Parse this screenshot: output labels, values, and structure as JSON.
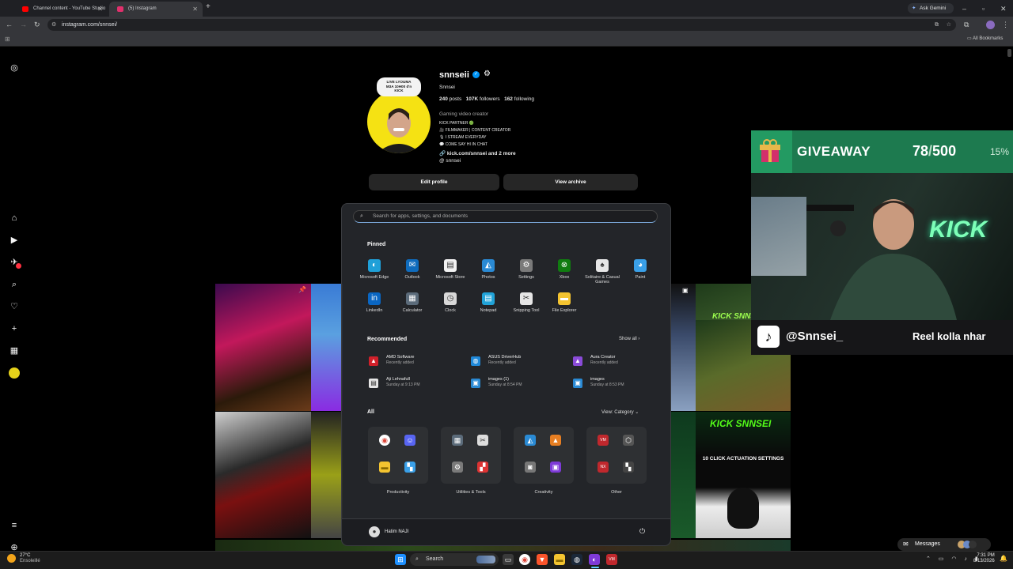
{
  "browser": {
    "tabs": [
      {
        "title": "Channel content - YouTube Studio",
        "favicon_color": "#ff0000"
      },
      {
        "title": "(5) Instagram",
        "favicon_color": "#e1306c"
      }
    ],
    "new_tab": "+",
    "ask_gemini": "Ask Gemini",
    "url": "instagram.com/snnsei/",
    "all_bookmarks": "All Bookmarks"
  },
  "profile": {
    "username": "snnseii",
    "display_name": "Snnsei",
    "live_badge": [
      "LIVE LYOUMA",
      "M3A 10H00 d'n",
      "KICK"
    ],
    "posts_count": "240",
    "posts_label": "posts",
    "followers_count": "107K",
    "followers_label": "followers",
    "following_count": "162",
    "following_label": "following",
    "category": "Gaming video creator",
    "bio_lines": [
      "KICK PARTNER 🟢",
      "🎥 FILMMAKER | CONTENT CREATOR",
      "🎙 I STREAM EVERYDAY",
      "💬 COME SAY HI IN CHAT"
    ],
    "link": "kick.com/snnsei and 2 more",
    "threads": "snnsei",
    "edit_profile": "Edit profile",
    "view_archive": "View archive"
  },
  "start_menu": {
    "search_placeholder": "Search for apps, settings, and documents",
    "pinned_title": "Pinned",
    "pinned": [
      {
        "label": "Microsoft Edge",
        "icon": "edge-icon",
        "color": "#1fa0d8"
      },
      {
        "label": "Outlook",
        "icon": "outlook-icon",
        "color": "#0f6cbd"
      },
      {
        "label": "Microsoft Store",
        "icon": "store-icon",
        "color": "#f2f2f2"
      },
      {
        "label": "Photos",
        "icon": "photos-icon",
        "color": "#2a8ad4"
      },
      {
        "label": "Settings",
        "icon": "settings-icon",
        "color": "#7a7a7a"
      },
      {
        "label": "Xbox",
        "icon": "xbox-icon",
        "color": "#107c10"
      },
      {
        "label": "Solitaire & Casual Games",
        "icon": "cards-icon",
        "color": "#e6e6e6"
      },
      {
        "label": "Paint",
        "icon": "paint-icon",
        "color": "#3aa0e8"
      },
      {
        "label": "LinkedIn",
        "icon": "linkedin-icon",
        "color": "#0a66c2"
      },
      {
        "label": "Calculator",
        "icon": "calculator-icon",
        "color": "#5b6b7a"
      },
      {
        "label": "Clock",
        "icon": "clock-icon",
        "color": "#d8d8d8"
      },
      {
        "label": "Notepad",
        "icon": "notepad-icon",
        "color": "#21a3d8"
      },
      {
        "label": "Snipping Tool",
        "icon": "snip-icon",
        "color": "#e6e6e6"
      },
      {
        "label": "File Explorer",
        "icon": "folder-icon",
        "color": "#f4c430"
      }
    ],
    "recommended_title": "Recommended",
    "show_all": "Show all",
    "recommended": [
      {
        "name": "AMD Software",
        "sub": "Recently added",
        "icon": "amd-icon",
        "color": "#d0202a"
      },
      {
        "name": "ASUS DriverHub",
        "sub": "Recently added",
        "icon": "asus-icon",
        "color": "#1f88d8"
      },
      {
        "name": "Aura Creator",
        "sub": "Recently added",
        "icon": "aura-icon",
        "color": "#8a4bd8"
      },
      {
        "name": "Aji Lehnafull",
        "sub": "Sunday at 9:13 PM",
        "icon": "file-icon",
        "color": "#e6e6e6"
      },
      {
        "name": "images (1)",
        "sub": "Sunday at 8:54 PM",
        "icon": "image-icon",
        "color": "#2a8ad4"
      },
      {
        "name": "images",
        "sub": "Sunday at 8:53 PM",
        "icon": "image-icon",
        "color": "#2a8ad4"
      }
    ],
    "all_title": "All",
    "view_category": "View: Category",
    "folders": [
      {
        "label": "Productivity"
      },
      {
        "label": "Utilities & Tools"
      },
      {
        "label": "Creativity"
      },
      {
        "label": "Other"
      }
    ],
    "user_name": "Hatim NAJI"
  },
  "overlay": {
    "giveaway_label": "GIVEAWAY",
    "giveaway_current": "78",
    "giveaway_sep": "/",
    "giveaway_goal": "500",
    "giveaway_percent": "15%",
    "giveaway_progress": 0.156,
    "tiktok_handle": "@Snnsei_",
    "tiktok_caption": "Reel kolla nhar",
    "kick_text": "KICK SNNSEI",
    "tile_caption": "10 CLICK ACTUATION SETTINGS"
  },
  "messages_label": "Messages",
  "taskbar": {
    "weather_temp": "27°C",
    "weather_desc": "Ensoleillé",
    "search": "Search",
    "time": "7:31 PM",
    "date": "8/13/2026"
  }
}
